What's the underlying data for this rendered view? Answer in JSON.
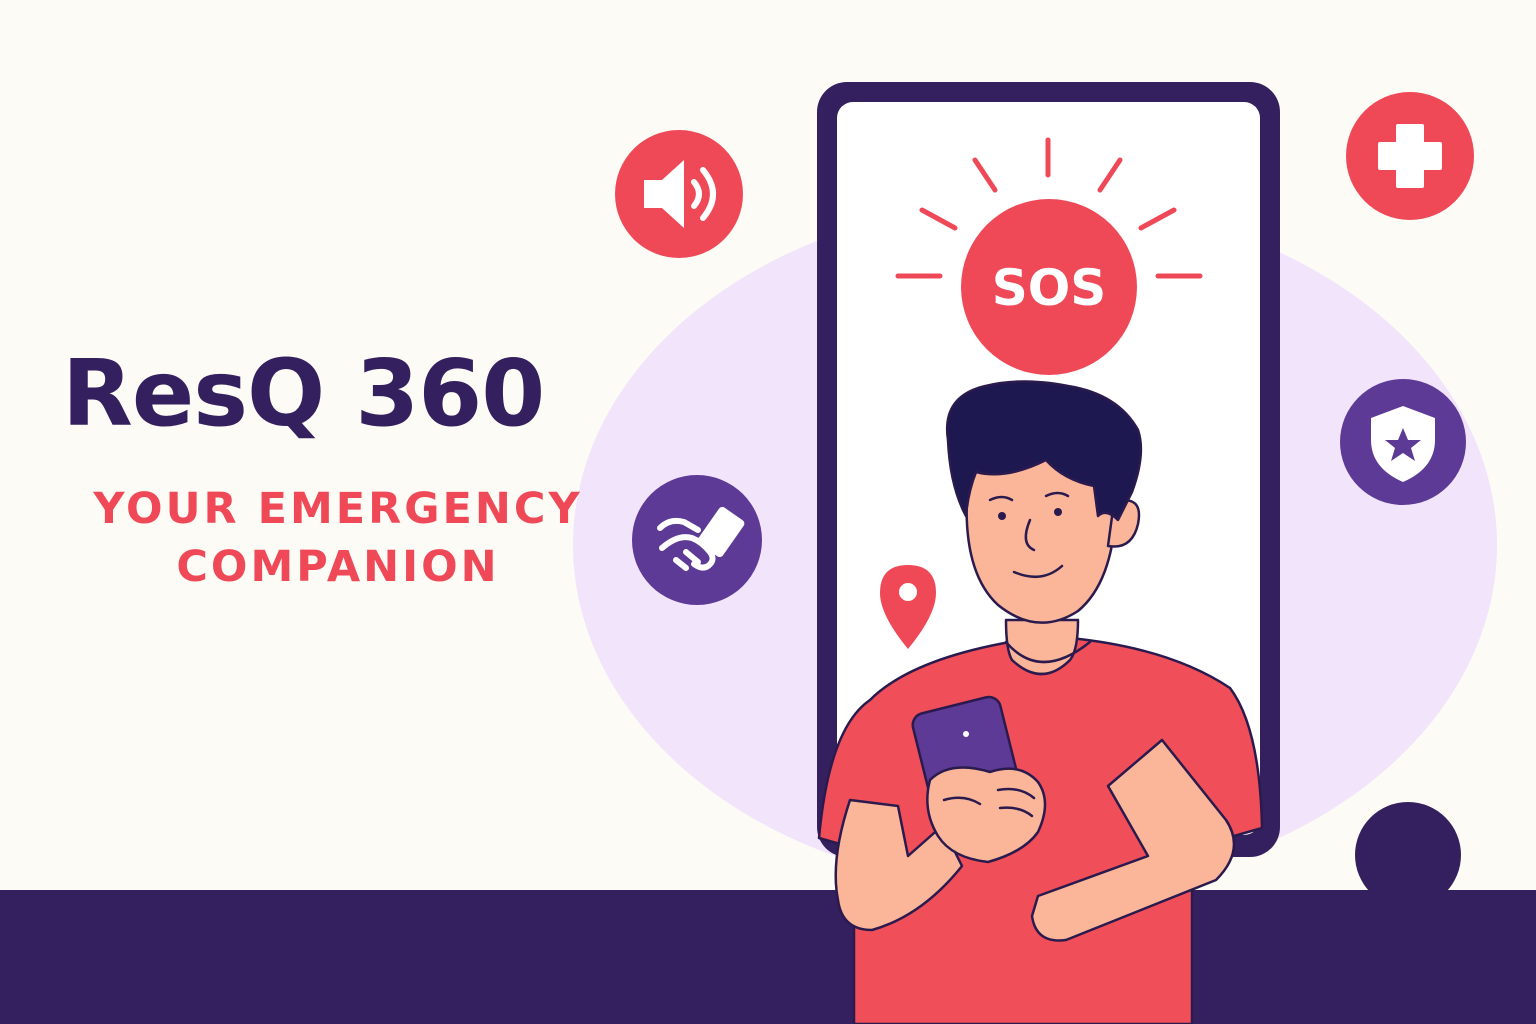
{
  "brand": {
    "title": "ResQ 360",
    "tagline_line1": "YOUR EMERGENCY",
    "tagline_line2": "COMPANION"
  },
  "phone_screen": {
    "sos_label": "SOS"
  },
  "icons": {
    "speaker": "speaker-icon",
    "medical": "medical-cross-icon",
    "shield": "shield-star-icon",
    "handshake": "handshake-icon",
    "location": "location-pin-icon"
  },
  "colors": {
    "background": "#fdfbf6",
    "primary_dark": "#35205f",
    "accent_red": "#ef4958",
    "purple": "#5d3a96",
    "lavender": "#f1e4fb",
    "skin": "#fbb69a",
    "shirt": "#f04f5a"
  }
}
